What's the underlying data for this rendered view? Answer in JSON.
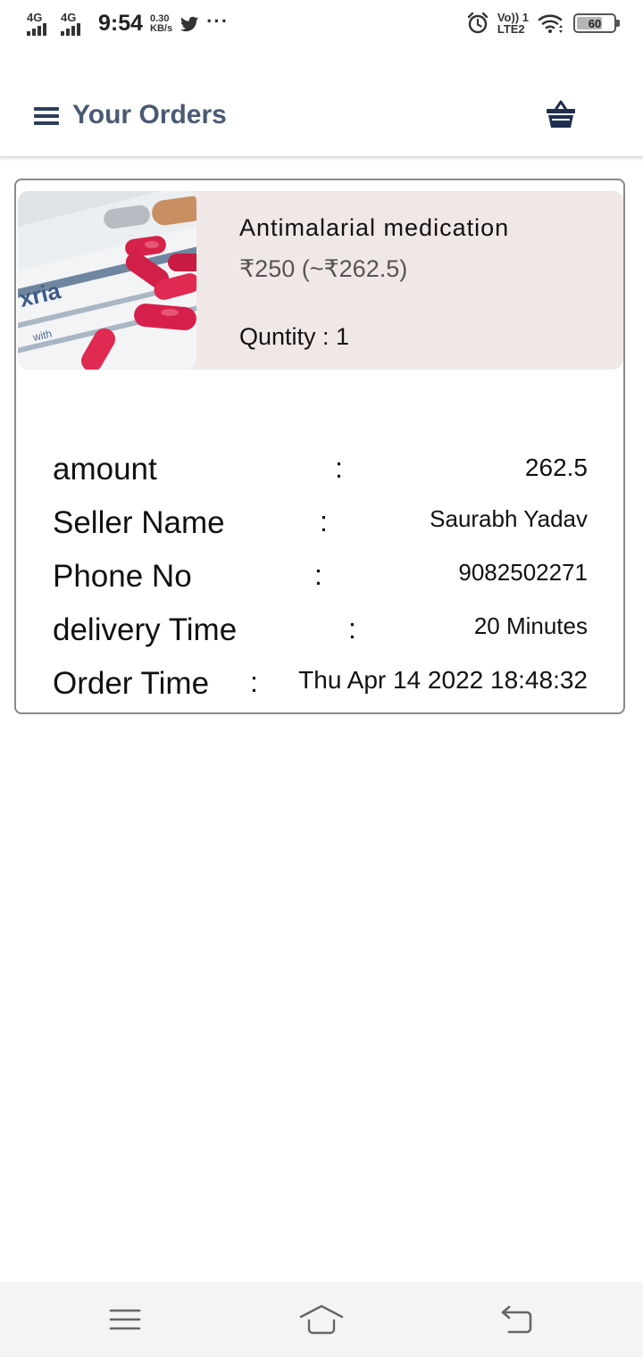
{
  "status_bar": {
    "network1": "4G",
    "network2": "4G",
    "time": "9:54",
    "speed_value": "0.30",
    "speed_unit": "KB/s",
    "notification_icons": [
      "twitter-icon",
      "more-dots-icon"
    ],
    "volte_top": "Vo)) 1",
    "volte_bottom": "LTE2",
    "battery": "60"
  },
  "header": {
    "title": "Your Orders",
    "menu_icon": "hamburger-menu-icon",
    "cart_icon": "basket-icon",
    "title_color": "#4a5a74",
    "icon_color": "#2b3f5c"
  },
  "order": {
    "product_name": "Antimalarial medication",
    "price": "₹250 (~₹262.5)",
    "quantity": "Quntity : 1",
    "details": [
      {
        "label": "amount",
        "value": "262.5"
      },
      {
        "label": "Seller Name",
        "value": "Saurabh Yadav"
      },
      {
        "label": "Phone No",
        "value": "9082502271"
      },
      {
        "label": "delivery Time",
        "value": "20 Minutes"
      },
      {
        "label": "Order Time",
        "value": "Thu Apr 14 2022 18:48:32"
      }
    ],
    "colon": ":",
    "card_bg": "#f0e8e6"
  },
  "nav_bar": {
    "icons": [
      "recent-apps-icon",
      "home-icon",
      "back-icon"
    ]
  }
}
